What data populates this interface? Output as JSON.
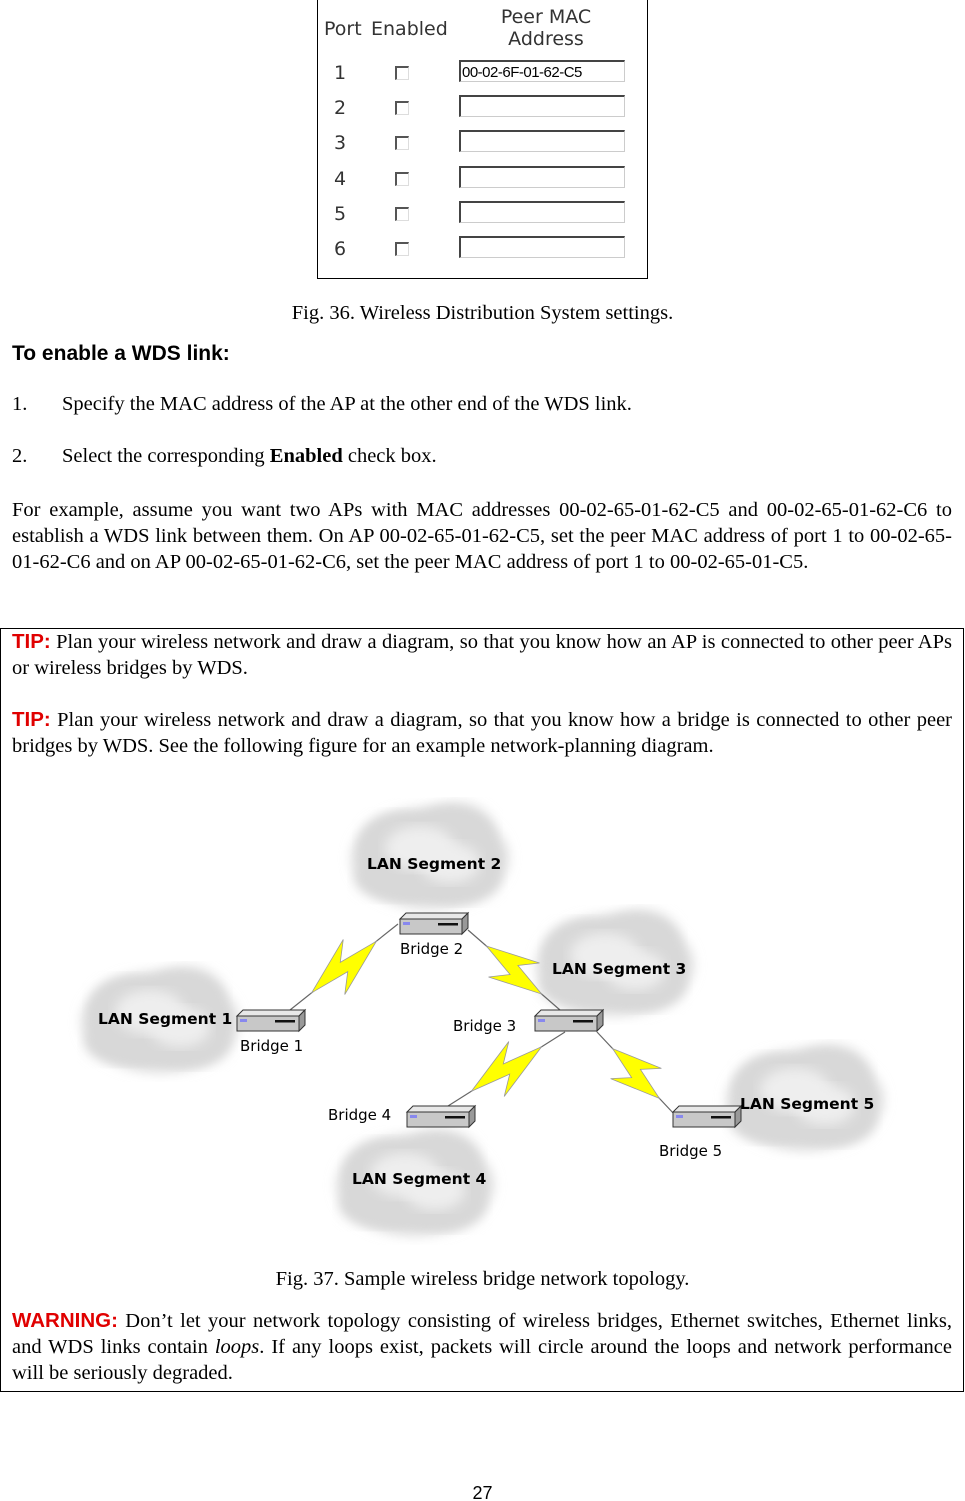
{
  "wds_panel": {
    "col_port": "Port",
    "col_enabled": "Enabled",
    "col_mac": "Peer MAC Address",
    "rows": [
      {
        "port": "1",
        "enabled": false,
        "mac": "00-02-6F-01-62-C5"
      },
      {
        "port": "2",
        "enabled": false,
        "mac": ""
      },
      {
        "port": "3",
        "enabled": false,
        "mac": ""
      },
      {
        "port": "4",
        "enabled": false,
        "mac": ""
      },
      {
        "port": "5",
        "enabled": false,
        "mac": ""
      },
      {
        "port": "6",
        "enabled": false,
        "mac": ""
      }
    ]
  },
  "fig36_caption": "Fig. 36. Wireless Distribution System settings.",
  "heading": "To enable a WDS link:",
  "steps": [
    {
      "num": "1.",
      "text": "Specify the MAC address of the AP at the other end of the WDS link."
    },
    {
      "num": "2.",
      "pre": "Select the corresponding ",
      "bold": "Enabled",
      "post": " check box."
    }
  ],
  "example": "For example, assume you want two APs with MAC addresses 00-02-65-01-62-C5 and 00-02-65-01-62-C6 to establish a WDS link between them. On AP 00-02-65-01-62-C5, set the peer MAC address of port 1 to 00-02-65-01-62-C6 and on AP 00-02-65-01-62-C6, set the peer MAC address of port 1 to 00-02-65-01-C5.",
  "tip1": {
    "label": "TIP:",
    "text": " Plan your wireless network and draw a diagram, so that you know how an AP is connected to other peer APs or wireless bridges by WDS."
  },
  "tip2": {
    "label": "TIP:",
    "text": " Plan your wireless network and draw a diagram, so that you know how a bridge is connected to other peer bridges by WDS. See the following figure for an example network-planning diagram."
  },
  "diagram": {
    "segments": [
      "LAN Segment 1",
      "LAN Segment 2",
      "LAN Segment 3",
      "LAN Segment 4",
      "LAN Segment 5"
    ],
    "bridges": [
      "Bridge 1",
      "Bridge 2",
      "Bridge 3",
      "Bridge 4",
      "Bridge 5"
    ],
    "bolt_color": "#ffff00"
  },
  "fig37_caption": "Fig. 37. Sample wireless bridge network topology.",
  "warning": {
    "label": "WARNING:",
    "pre": " Don’t let your network topology consisting of wireless bridges, Ethernet switches, Ethernet links, and WDS links contain ",
    "italic": "loops",
    "post": ". If any loops exist, packets will circle around the loops and network performance will be seriously degraded."
  },
  "page_number": "27"
}
